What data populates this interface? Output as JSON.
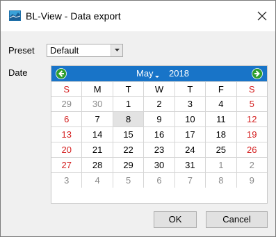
{
  "window": {
    "title": "BL-View - Data export",
    "close_symbol": "✕"
  },
  "form": {
    "preset_label": "Preset",
    "preset_value": "Default",
    "date_label": "Date"
  },
  "calendar": {
    "month": "May",
    "year": "2018",
    "weekdays": [
      "S",
      "M",
      "T",
      "W",
      "T",
      "F",
      "S"
    ],
    "selected_day": "8",
    "weeks": [
      [
        "29",
        "30",
        "1",
        "2",
        "3",
        "4",
        "5"
      ],
      [
        "6",
        "7",
        "8",
        "9",
        "10",
        "11",
        "12"
      ],
      [
        "13",
        "14",
        "15",
        "16",
        "17",
        "18",
        "19"
      ],
      [
        "20",
        "21",
        "22",
        "23",
        "24",
        "25",
        "26"
      ],
      [
        "27",
        "28",
        "29",
        "30",
        "31",
        "1",
        "2"
      ],
      [
        "3",
        "4",
        "5",
        "6",
        "7",
        "8",
        "9"
      ]
    ]
  },
  "buttons": {
    "ok": "OK",
    "cancel": "Cancel"
  },
  "colors": {
    "header_blue": "#1874c8",
    "weekend_red": "#d42020",
    "other_month_gray": "#8a8a8a",
    "nav_green": "#2e9e2e",
    "selected_bg": "#e3e3e3"
  }
}
